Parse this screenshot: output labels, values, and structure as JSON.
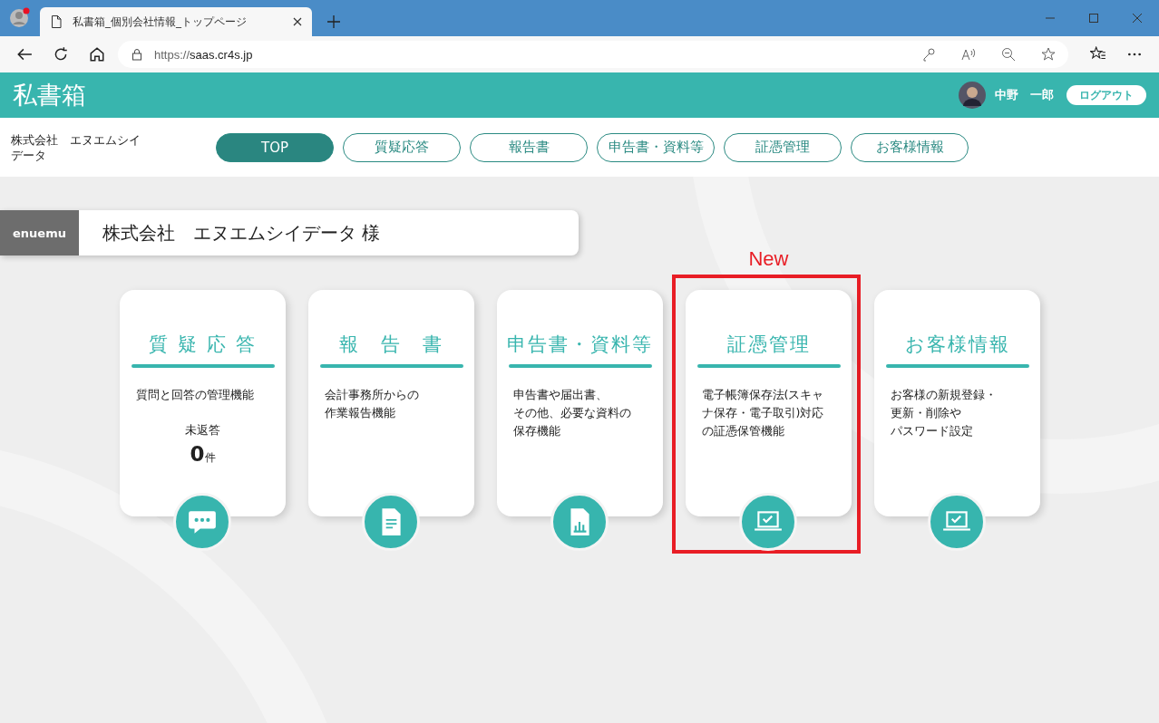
{
  "browser": {
    "tab_title": "私書箱_個別会社情報_トップページ",
    "url_scheme": "https://",
    "url_host": "saas.cr4s.jp"
  },
  "header": {
    "logo": "私書箱",
    "user_name": "中野　一郎",
    "logout": "ログアウト"
  },
  "company_short": "株式会社　エヌエムシイデータ",
  "nav": [
    {
      "label": "TOP",
      "selected": true
    },
    {
      "label": "質疑応答",
      "selected": false
    },
    {
      "label": "報告書",
      "selected": false
    },
    {
      "label": "申告書・資料等",
      "selected": false
    },
    {
      "label": "証憑管理",
      "selected": false
    },
    {
      "label": "お客様情報",
      "selected": false
    }
  ],
  "banner": {
    "tag": "enuemu",
    "title": "株式会社　エヌエムシイデータ 様"
  },
  "cards": [
    {
      "title": "質 疑 応 答",
      "lines": [
        "質問と回答の管理機能"
      ],
      "pending_label": "未返答",
      "pending_count": "0",
      "pending_unit": "件",
      "kind": "chat",
      "highlighted": false
    },
    {
      "title": "報　告　書",
      "lines": [
        "会計事務所からの",
        "作業報告機能"
      ],
      "kind": "document",
      "highlighted": false
    },
    {
      "title": "申告書・資料等",
      "lines": [
        "申告書や届出書、",
        "その他、必要な資料の",
        "保存機能"
      ],
      "kind": "chart",
      "highlighted": false
    },
    {
      "title": "証憑管理",
      "lines": [
        "電子帳簿保存法(スキャ",
        "ナ保存・電子取引)対応",
        "の証憑保管機能"
      ],
      "kind": "laptop",
      "highlighted": true,
      "highlight_label": "New"
    },
    {
      "title": "お客様情報",
      "lines": [
        "お客様の新規登録・",
        "更新・削除や",
        "パスワード設定"
      ],
      "kind": "laptop",
      "highlighted": false
    }
  ]
}
